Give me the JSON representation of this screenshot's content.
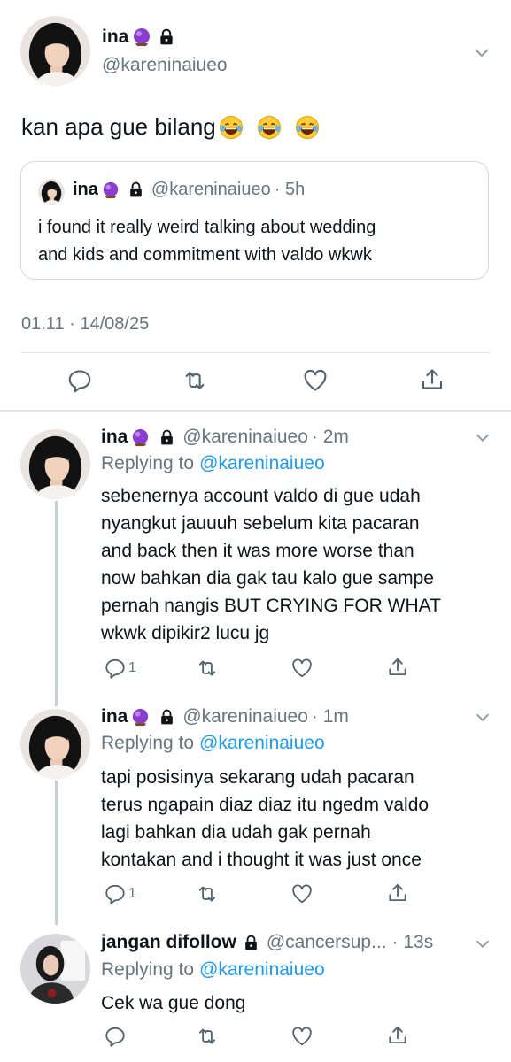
{
  "main_tweet": {
    "name": "ina",
    "handle": "@kareninaiueo",
    "text": "kan apa gue bilang",
    "emojis": [
      "face-with-tears-of-joy",
      "face-with-tears-of-joy",
      "face-with-tears-of-joy"
    ],
    "timestamp": "01.11 · 14/08/25"
  },
  "quoted_tweet": {
    "name": "ina",
    "handle": "@kareninaiueo",
    "time": "· 5h",
    "text_line1": "i found it really weird talking about wedding",
    "text_line2": "and kids and commitment with valdo wkwk"
  },
  "replies": [
    {
      "name": "ina",
      "handle": "@kareninaiueo",
      "time": "· 2m",
      "replying_label": "Replying to",
      "replying_to": "@kareninaiueo",
      "lines": [
        "sebenernya account valdo di gue udah",
        "nyangkut jauuuh sebelum kita pacaran",
        "and back then it was more worse than",
        "now bahkan dia gak tau kalo gue sampe",
        "pernah nangis BUT CRYING FOR WHAT",
        "wkwk dipikir2 lucu jg"
      ],
      "reply_count": "1"
    },
    {
      "name": "ina",
      "handle": "@kareninaiueo",
      "time": "· 1m",
      "replying_label": "Replying to",
      "replying_to": "@kareninaiueo",
      "lines": [
        "tapi posisinya sekarang udah pacaran",
        "terus ngapain diaz diaz itu ngedm valdo",
        "lagi bahkan dia udah gak pernah",
        "kontakan and i thought it was just once"
      ],
      "reply_count": "1"
    },
    {
      "name": "jangan difollow",
      "handle": "@cancersup...",
      "time": "· 13s",
      "replying_label": "Replying to",
      "replying_to": "@kareninaiueo",
      "lines": [
        "Cek wa gue dong"
      ],
      "reply_count": ""
    }
  ],
  "icons": {
    "badge": "crystal-ball-icon",
    "protected": "lock-icon",
    "more": "chevron-down-icon",
    "reply": "reply-icon",
    "retweet": "retweet-icon",
    "like": "heart-icon",
    "share": "share-icon"
  },
  "colors": {
    "text": "#0f1419",
    "muted": "#66757f",
    "link": "#1d9bf0",
    "thread_line": "#c4cfd6",
    "divider": "#e1e8ed",
    "badge": "#8b3dd1"
  }
}
